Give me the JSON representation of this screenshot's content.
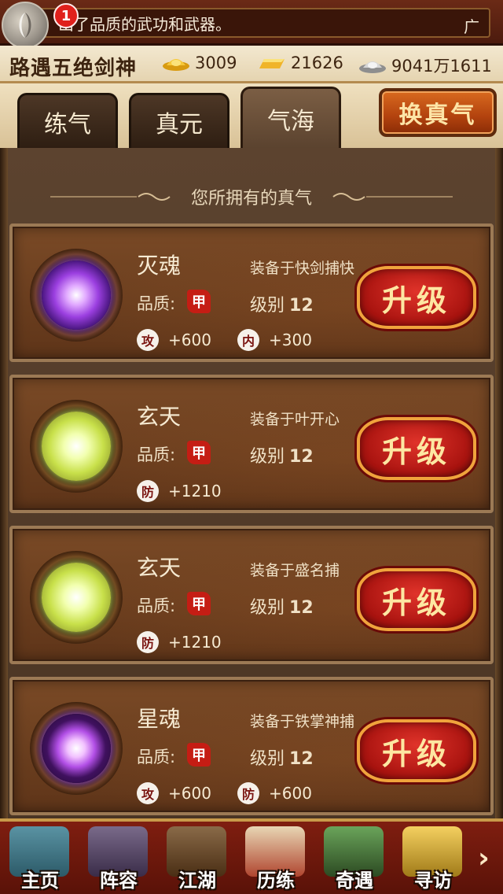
{
  "marquee": {
    "text": "出了品质的武功和武器。",
    "end_mark": "广",
    "notification_count": "1"
  },
  "player": {
    "name": "路遇五绝剑神",
    "gold": "3009",
    "ingot": "21626",
    "silver": "9041万1611"
  },
  "tabs": [
    {
      "label": "练气",
      "active": false
    },
    {
      "label": "真元",
      "active": false
    },
    {
      "label": "气海",
      "active": true
    }
  ],
  "swap_button": "换真气",
  "section_title": "您所拥有的真气",
  "quality_label": "品质:",
  "level_label": "级别",
  "upgrade_label": "升级",
  "cards": [
    {
      "name": "灭魂",
      "orb": "purple-orb",
      "equipped": "装备于快剑捕快",
      "grade": "甲",
      "level": "12",
      "stats": [
        {
          "icon": "攻",
          "value": "+600"
        },
        {
          "icon": "内",
          "value": "+300"
        }
      ]
    },
    {
      "name": "玄天",
      "orb": "green-orb",
      "equipped": "装备于叶开心",
      "grade": "甲",
      "level": "12",
      "stats": [
        {
          "icon": "防",
          "value": "+1210"
        }
      ]
    },
    {
      "name": "玄天",
      "orb": "green-orb",
      "equipped": "装备于盛名捕",
      "grade": "甲",
      "level": "12",
      "stats": [
        {
          "icon": "防",
          "value": "+1210"
        }
      ]
    },
    {
      "name": "星魂",
      "orb": "violet-orb",
      "equipped": "装备于铁掌神捕",
      "grade": "甲",
      "level": "12",
      "stats": [
        {
          "icon": "攻",
          "value": "+600"
        },
        {
          "icon": "防",
          "value": "+600"
        }
      ]
    }
  ],
  "nav": [
    {
      "label": "主页",
      "icon": "house-icon",
      "color": "#3f7a8c"
    },
    {
      "label": "阵容",
      "icon": "hero-icon",
      "color": "#5a4a6a"
    },
    {
      "label": "江湖",
      "icon": "sword-gourd-icon",
      "color": "#6a4a2a"
    },
    {
      "label": "历练",
      "icon": "scroll-icon",
      "color": "#a03a2a"
    },
    {
      "label": "奇遇",
      "icon": "mountain-icon",
      "color": "#3f6a3a"
    },
    {
      "label": "寻访",
      "icon": "treasure-icon",
      "color": "#b38a2a"
    }
  ],
  "colors": {
    "accent_red": "#c51d14",
    "gold_text": "#fde7a2"
  }
}
